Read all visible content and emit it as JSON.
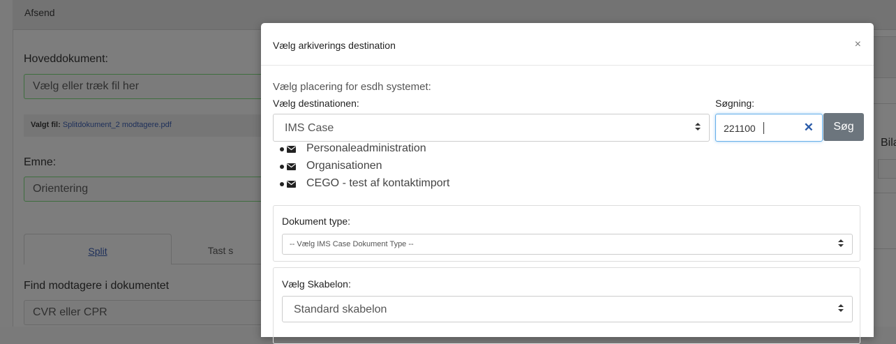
{
  "background": {
    "header_title": "Afsend",
    "main_doc_label": "Hoveddokument:",
    "file_placeholder": "Vælg eller træk fil her",
    "selected_file_prefix": "Valgt fil:",
    "selected_file_name": "Splitdokument_2 modtagere.pdf",
    "subject_label": "Emne:",
    "subject_value": "Orientering",
    "tabs": [
      {
        "label": "Split"
      },
      {
        "label": "Tast s"
      }
    ],
    "find_label": "Find modtagere i dokumentet",
    "cvr_placeholder": "CVR eller CPR",
    "right_label": "Bila"
  },
  "modal": {
    "title": "Vælg arkiverings destination",
    "close_glyph": "×",
    "helper_text": "Vælg placering for esdh systemet:",
    "destination_label": "Vælg destinationen:",
    "destination_value": "IMS Case",
    "search_label": "Søgning:",
    "search_value": "221100",
    "clear_glyph": "✕",
    "search_button": "Søg",
    "destinations": [
      {
        "label": "Personaleadministration",
        "icon": "envelope-icon"
      },
      {
        "label": "Organisationen",
        "icon": "envelope-icon"
      },
      {
        "label": "CEGO - test af kontaktimport",
        "icon": "envelope-icon"
      }
    ],
    "doc_type_label": "Dokument type:",
    "doc_type_placeholder": "-- Vælg IMS Case Dokument Type --",
    "template_label": "Vælg Skabelon:",
    "template_value": "Standard skabelon",
    "select_arrow_glyph": "▲▼"
  }
}
